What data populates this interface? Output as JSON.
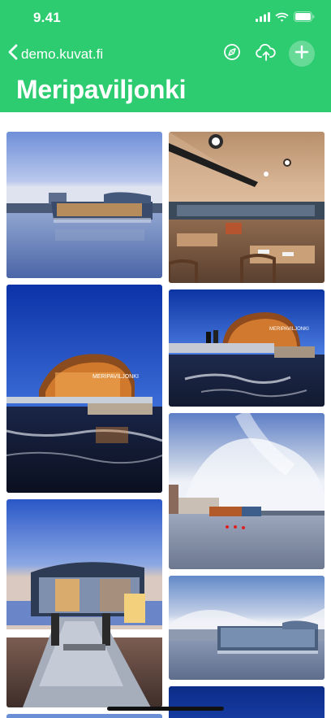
{
  "status_bar": {
    "time": "9.41",
    "icons": [
      "signal-icon",
      "wifi-icon",
      "battery-icon"
    ]
  },
  "nav": {
    "back_label": "demo.kuvat.fi",
    "icons": [
      "back-chevron-icon",
      "compass-icon",
      "cloud-upload-icon",
      "plus-icon"
    ]
  },
  "album": {
    "title": "Meripaviljonki"
  },
  "colors": {
    "header_green": "#2ecc71",
    "header_text": "#ffffff",
    "background": "#ffffff"
  },
  "photos": [
    {
      "id": "photo-1",
      "subject": "glass pavilion at dusk over calm water"
    },
    {
      "id": "photo-2",
      "subject": "restaurant interior with wooden tables"
    },
    {
      "id": "photo-3",
      "subject": "copper pavilion at night with blue sky"
    },
    {
      "id": "photo-4",
      "subject": "pavilion facade with people on deck"
    },
    {
      "id": "photo-5",
      "subject": "cloudy sky over sea and pavilion"
    },
    {
      "id": "photo-6",
      "subject": "pavilion entrance walkway at dusk"
    },
    {
      "id": "photo-7",
      "subject": "glass pavilion in daylight"
    },
    {
      "id": "photo-8",
      "subject": "dark blue sky"
    },
    {
      "id": "photo-9",
      "subject": "partial photo"
    }
  ]
}
